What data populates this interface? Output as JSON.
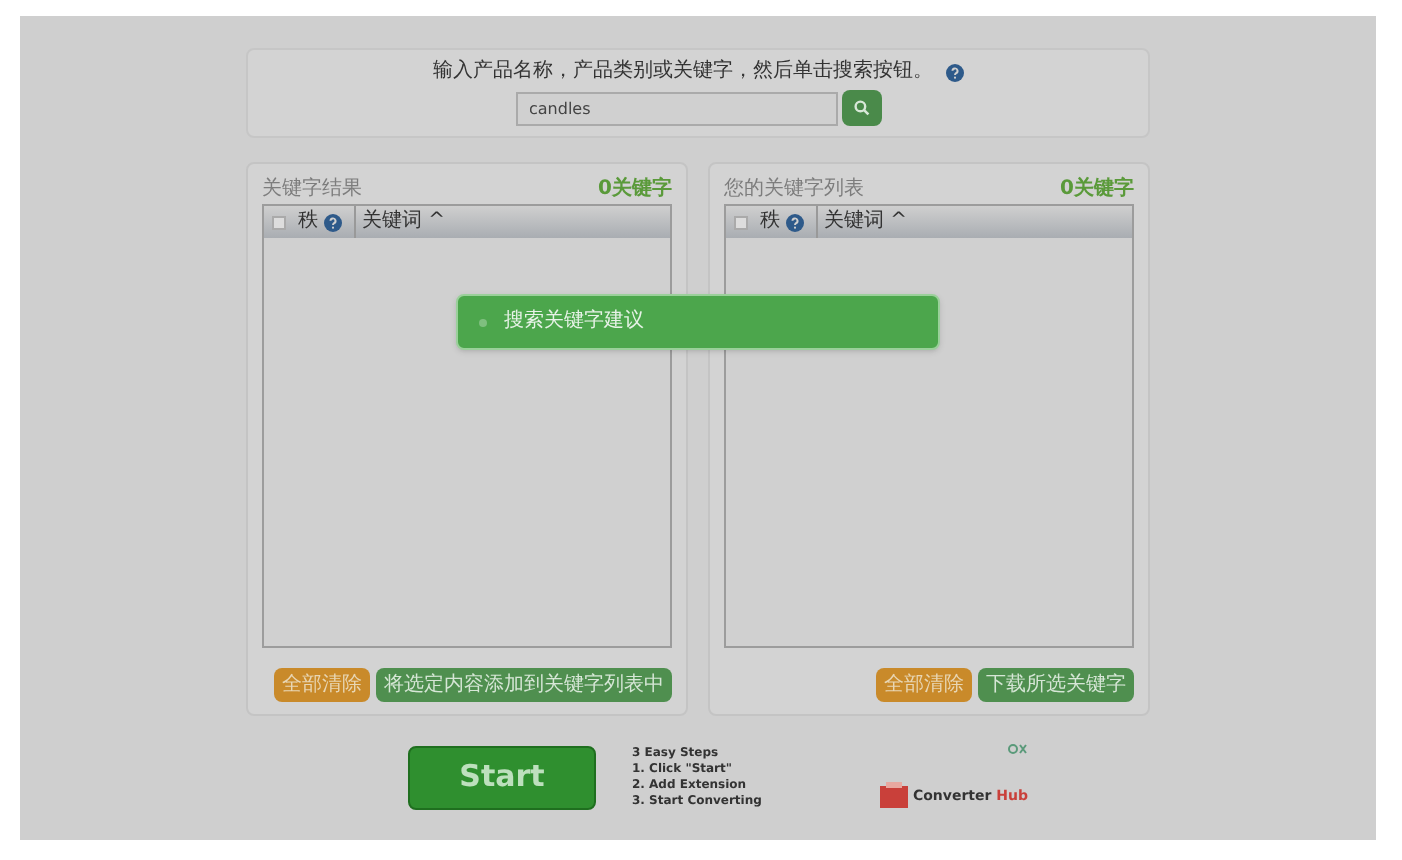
{
  "search": {
    "prompt": "输入产品名称，产品类别或关键字，然后单击搜索按钮。",
    "value": "candles"
  },
  "panels": [
    {
      "title": "关键字结果",
      "count": "0关键字",
      "all_checked": false,
      "columns": [
        {
          "label": "秩",
          "help": true
        },
        {
          "label": "关键词 ^",
          "help": false
        }
      ],
      "buttons": [
        {
          "label": "全部清除",
          "kind": "warning"
        },
        {
          "label": "将选定内容添加到关键字列表中",
          "kind": "success"
        }
      ]
    },
    {
      "title": "您的关键字列表",
      "count": "0关键字",
      "all_checked": false,
      "columns": [
        {
          "label": "秩",
          "help": true
        },
        {
          "label": "关键词 ^",
          "help": false
        }
      ],
      "buttons": [
        {
          "label": "全部清除",
          "kind": "warning"
        },
        {
          "label": "下载所选关键字",
          "kind": "success"
        }
      ]
    }
  ],
  "dialog": {
    "message": "搜索关键字建议"
  },
  "ad": {
    "button": "Start",
    "heading": "3 Easy Steps",
    "steps": [
      "1. Click \"Start\"",
      "2. Add Extension",
      "3. Start Converting"
    ],
    "brand": "Converter",
    "brand_suffix": "Hub"
  }
}
